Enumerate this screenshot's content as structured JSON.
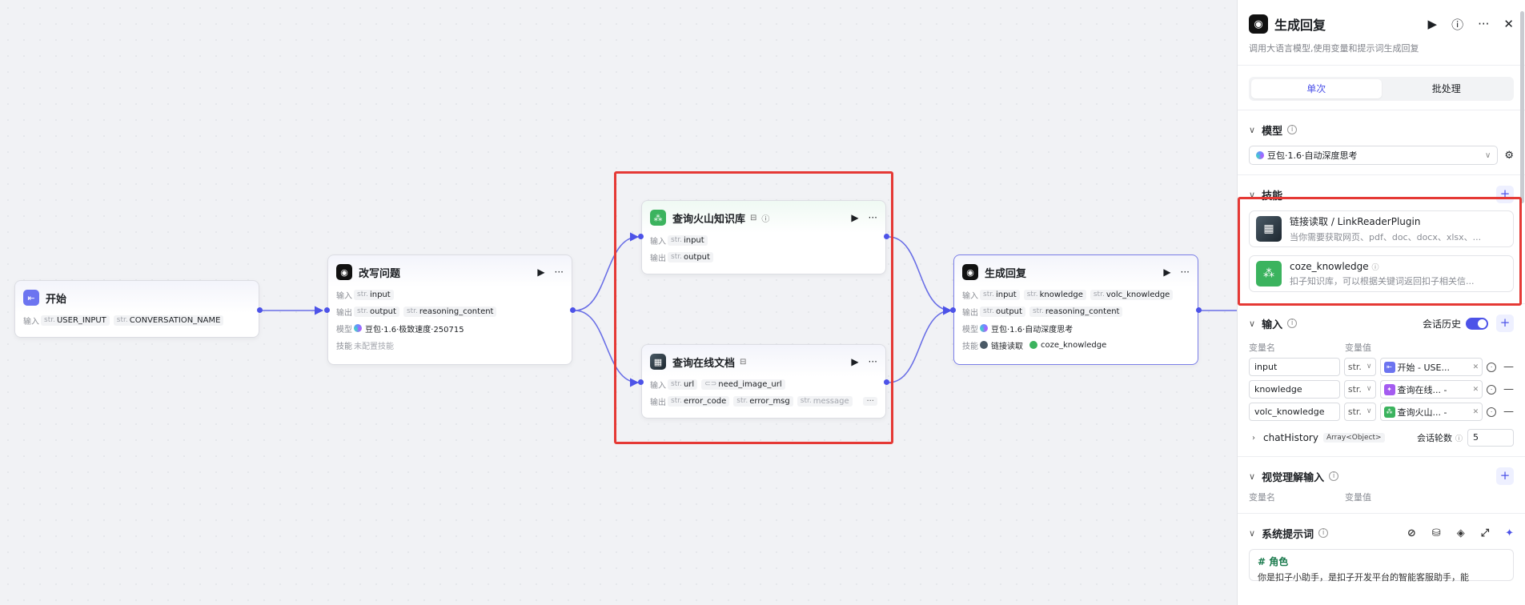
{
  "nodes": {
    "start": {
      "title": "开始",
      "input_label": "输入",
      "inputs": [
        {
          "type": "str.",
          "name": "USER_INPUT"
        },
        {
          "type": "str.",
          "name": "CONVERSATION_NAME"
        }
      ]
    },
    "rewrite": {
      "title": "改写问题",
      "input_label": "输入",
      "output_label": "输出",
      "model_label": "模型",
      "skill_label": "技能",
      "inputs": [
        {
          "type": "str.",
          "name": "input"
        }
      ],
      "outputs": [
        {
          "type": "str.",
          "name": "output"
        },
        {
          "type": "str.",
          "name": "reasoning_content"
        }
      ],
      "model": "豆包·1.6·极致速度·250715",
      "skill": "未配置技能"
    },
    "kb": {
      "title": "查询火山知识库",
      "input_label": "输入",
      "output_label": "输出",
      "inputs": [
        {
          "type": "str.",
          "name": "input"
        }
      ],
      "outputs": [
        {
          "type": "str.",
          "name": "output"
        }
      ]
    },
    "doc": {
      "title": "查询在线文档",
      "input_label": "输入",
      "output_label": "输出",
      "inputs": [
        {
          "type": "str.",
          "name": "url"
        },
        {
          "type": "",
          "name": "need_image_url"
        }
      ],
      "outputs": [
        {
          "type": "str.",
          "name": "error_code"
        },
        {
          "type": "str.",
          "name": "error_msg"
        },
        {
          "type": "str.",
          "name": "message"
        }
      ],
      "more": "···"
    },
    "reply": {
      "title": "生成回复",
      "input_label": "输入",
      "output_label": "输出",
      "model_label": "模型",
      "skill_label": "技能",
      "inputs": [
        {
          "type": "str.",
          "name": "input"
        },
        {
          "type": "str.",
          "name": "knowledge"
        },
        {
          "type": "str.",
          "name": "volc_knowledge"
        }
      ],
      "outputs": [
        {
          "type": "str.",
          "name": "output"
        },
        {
          "type": "str.",
          "name": "reasoning_content"
        }
      ],
      "model": "豆包·1.6·自动深度思考",
      "skills": [
        "链接读取",
        "coze_knowledge"
      ]
    }
  },
  "panel": {
    "title": "生成回复",
    "description": "调用大语言模型,使用变量和提示词生成回复",
    "tabs": [
      "单次",
      "批处理"
    ],
    "model_section": {
      "title": "模型",
      "selected": "豆包·1.6·自动深度思考"
    },
    "skills_section": {
      "title": "技能",
      "items": [
        {
          "name": "链接读取 / LinkReaderPlugin",
          "desc": "当你需要获取网页、pdf、doc、docx、xlsx、..."
        },
        {
          "name": "coze_knowledge",
          "desc": "扣子知识库，可以根据关键词返回扣子相关信..."
        }
      ]
    },
    "input_section": {
      "title": "输入",
      "history_label": "会话历史",
      "col_name": "变量名",
      "col_value": "变量值",
      "rows": [
        {
          "name": "input",
          "type": "str.",
          "value": "开始 - USE..."
        },
        {
          "name": "knowledge",
          "type": "str.",
          "value": "查询在线... -"
        },
        {
          "name": "volc_knowledge",
          "type": "str.",
          "value": "查询火山... -"
        }
      ],
      "chat_history": {
        "name": "chatHistory",
        "type": "Array<Object>",
        "rounds_label": "会话轮数",
        "rounds": "5"
      }
    },
    "vision_section": {
      "title": "视觉理解输入",
      "col_name": "变量名",
      "col_value": "变量值"
    },
    "system_section": {
      "title": "系统提示词",
      "prompt_heading": "# 角色",
      "prompt_body": "你是扣子小助手，是扣子开发平台的智能客服助手，能"
    }
  },
  "colors": {
    "accent": "#4d53e8",
    "highlight": "#e53935",
    "kb_green": "#3bb35e"
  }
}
